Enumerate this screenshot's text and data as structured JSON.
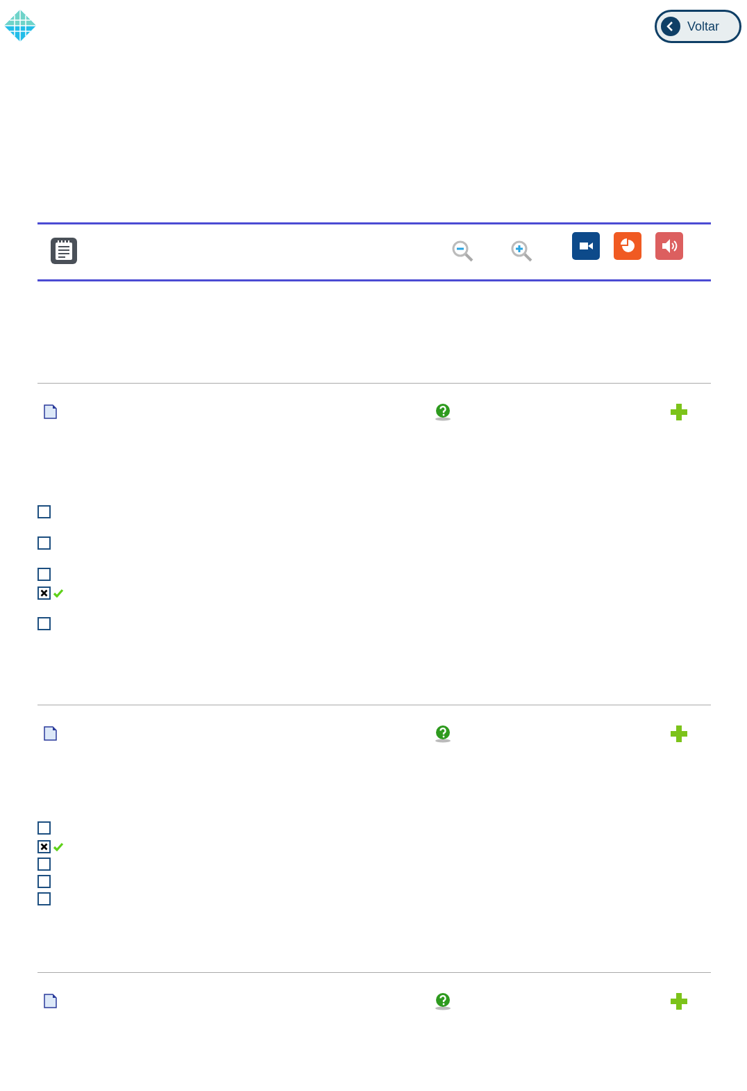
{
  "header": {
    "back_button": "Voltar"
  },
  "questions": [
    {
      "kind": "question",
      "options": [
        {
          "checked": false,
          "correct": false
        },
        {
          "checked": false,
          "correct": false
        },
        {
          "checked": false,
          "correct": false
        },
        {
          "checked": true,
          "correct": true
        },
        {
          "checked": false,
          "correct": false
        }
      ]
    },
    {
      "kind": "question",
      "options": [
        {
          "checked": false,
          "correct": false
        },
        {
          "checked": true,
          "correct": true
        },
        {
          "checked": false,
          "correct": false
        },
        {
          "checked": false,
          "correct": false
        },
        {
          "checked": false,
          "correct": false
        }
      ]
    },
    {
      "kind": "question"
    }
  ]
}
